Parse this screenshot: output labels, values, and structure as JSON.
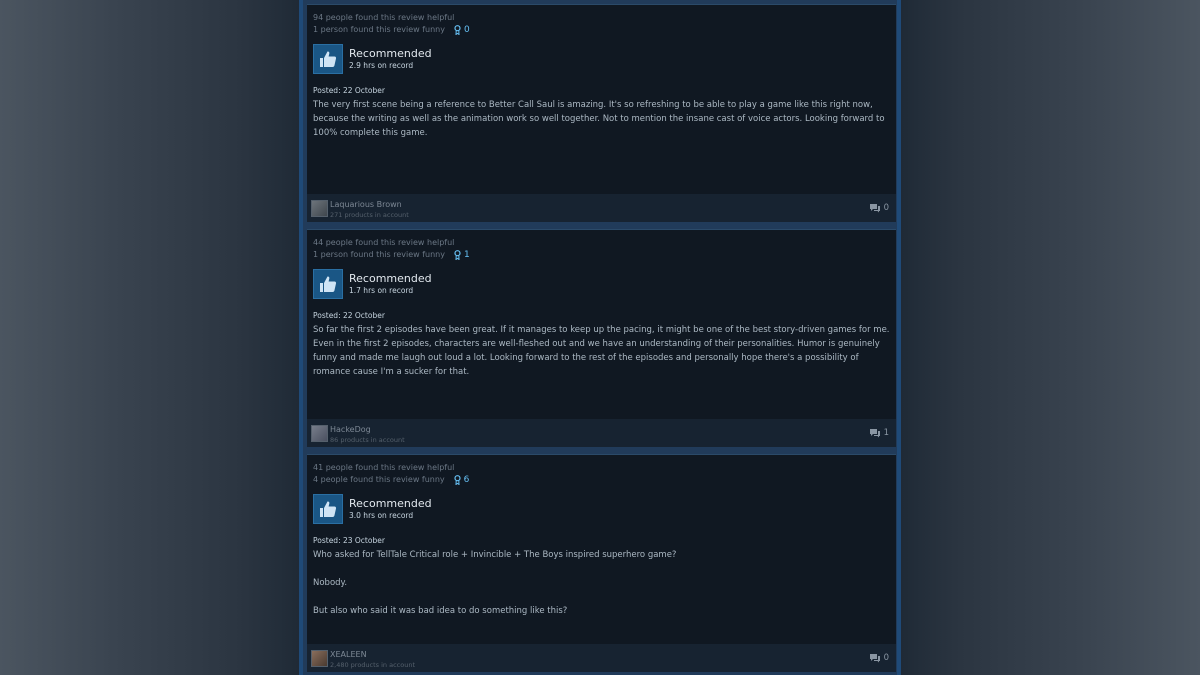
{
  "reviews": [
    {
      "helpful": "94 people found this review helpful",
      "funny": "1 person found this review funny",
      "award_count": "0",
      "verdict": "Recommended",
      "hours": "2.9 hrs on record",
      "posted": "Posted: 22 October",
      "body": [
        "The very first scene being a reference to Better Call Saul is amazing. It's so refreshing to be able to play a game like this right now, because the writing as well as the animation work so well together. Not to mention the insane cast of voice actors. Looking forward to 100% complete this game."
      ],
      "author": "Laquarious Brown",
      "products": "271 products in account",
      "comment_count": "0"
    },
    {
      "helpful": "44 people found this review helpful",
      "funny": "1 person found this review funny",
      "award_count": "1",
      "verdict": "Recommended",
      "hours": "1.7 hrs on record",
      "posted": "Posted: 22 October",
      "body": [
        "So far the first 2 episodes have been great. If it manages to keep up the pacing, it might be one of the best story-driven games for me. Even in the first 2 episodes, characters are well-fleshed out and we have an understanding of their personalities. Humor is genuinely funny and made me laugh out loud a lot. Looking forward to the rest of the episodes and personally hope there's a possibility of romance cause I'm a sucker for that."
      ],
      "author": "HackeDog",
      "products": "86 products in account",
      "comment_count": "1"
    },
    {
      "helpful": "41 people found this review helpful",
      "funny": "4 people found this review funny",
      "award_count": "6",
      "verdict": "Recommended",
      "hours": "3.0 hrs on record",
      "posted": "Posted: 23 October",
      "body": [
        "Who asked for TellTale Critical role + Invincible + The Boys inspired superhero game?",
        "Nobody.",
        "But also who said it was bad idea to do something like this?"
      ],
      "author": "XEALEEN",
      "products": "2,480 products in account",
      "comment_count": "0"
    }
  ],
  "icons": {
    "thumb": "thumbs-up-icon",
    "award": "award-icon",
    "comment": "comment-icon"
  },
  "colors": {
    "accent": "#66c0f4",
    "thumb_bg": "#1a5685"
  }
}
